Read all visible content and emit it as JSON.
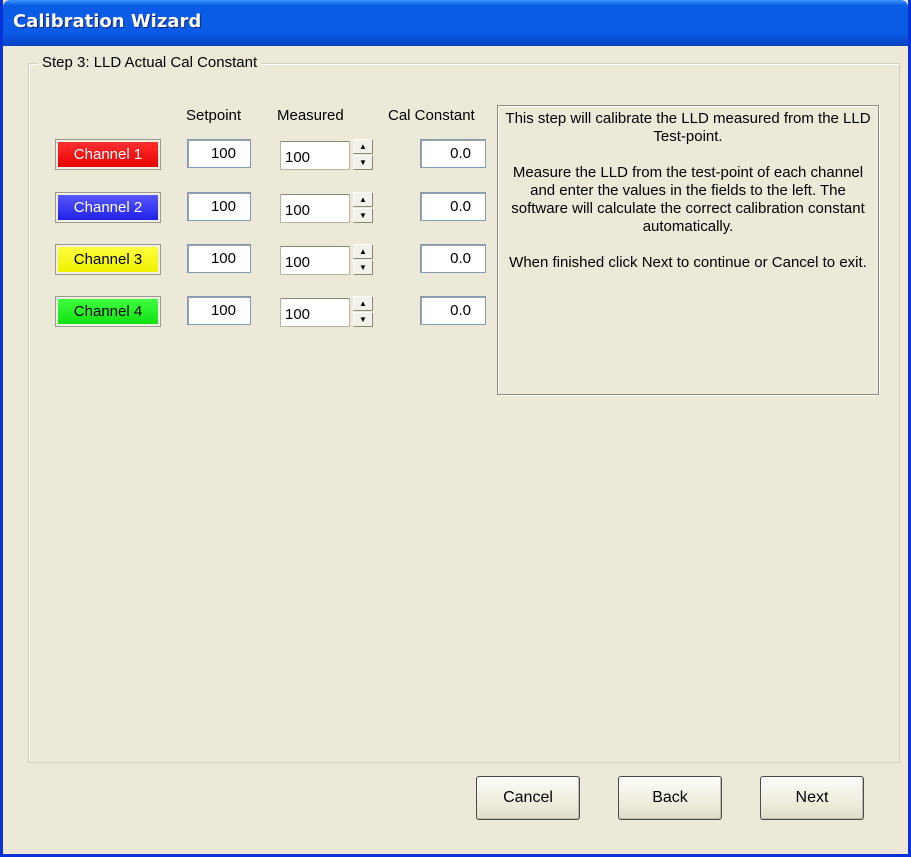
{
  "window": {
    "title": "Calibration Wizard"
  },
  "step": {
    "legend": "Step 3:  LLD Actual Cal Constant"
  },
  "columns": {
    "setpoint": "Setpoint",
    "measured": "Measured",
    "cal_constant": "Cal Constant"
  },
  "channels": [
    {
      "label": "Channel 1",
      "color": "#ff0000",
      "setpoint": "100",
      "measured": "100",
      "cal_constant": "0.0"
    },
    {
      "label": "Channel 2",
      "color": "#3333ff",
      "setpoint": "100",
      "measured": "100",
      "cal_constant": "0.0"
    },
    {
      "label": "Channel 3",
      "color": "#ffff00",
      "setpoint": "100",
      "measured": "100",
      "cal_constant": "0.0"
    },
    {
      "label": "Channel 4",
      "color": "#22ee22",
      "setpoint": "100",
      "measured": "100",
      "cal_constant": "0.0"
    }
  ],
  "info": {
    "p1": "This step will calibrate the LLD measured from the LLD Test-point.",
    "p2": "Measure the LLD from the test-point of each channel and enter the values in the fields to the left.  The software will calculate the correct calibration constant automatically.",
    "p3": "When finished click Next to continue or Cancel to exit."
  },
  "buttons": {
    "cancel": "Cancel",
    "back": "Back",
    "next": "Next"
  }
}
